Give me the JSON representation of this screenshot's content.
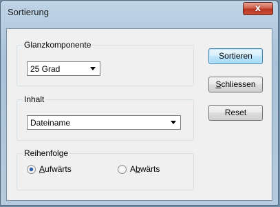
{
  "window": {
    "title": "Sortierung",
    "close_glyph": "x"
  },
  "glanz": {
    "label": "Glanzkomponente",
    "value": "25 Grad"
  },
  "inhalt": {
    "label": "Inhalt",
    "value": "Dateiname"
  },
  "reihenfolge": {
    "label": "Reihenfolge",
    "options": [
      {
        "pre": "",
        "ul": "A",
        "post": "ufwärts",
        "checked": true
      },
      {
        "pre": "A",
        "ul": "b",
        "post": "wärts",
        "checked": false
      }
    ]
  },
  "buttons": {
    "sort": "Sortieren",
    "close_ul": "S",
    "close_rest": "chliessen",
    "reset": "Reset"
  },
  "colors": {
    "titlebar": "#b6cbdd",
    "close": "#c9523e",
    "default_button": "#a7d9f5"
  }
}
